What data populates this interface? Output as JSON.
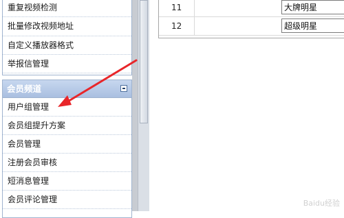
{
  "sidebar": {
    "top_items": [
      {
        "label": "重复视频检测"
      },
      {
        "label": "批量修改视频地址"
      },
      {
        "label": "自定义播放器格式"
      },
      {
        "label": "举报信管理"
      }
    ],
    "member_panel": {
      "title": "会员频道",
      "items": [
        {
          "label": "用户组管理"
        },
        {
          "label": "会员组提升方案"
        },
        {
          "label": "会员管理"
        },
        {
          "label": "注册会员审核"
        },
        {
          "label": "短消息管理"
        },
        {
          "label": "会员评论管理"
        }
      ]
    }
  },
  "table": {
    "rows": [
      {
        "num": "11",
        "name": "大牌明星"
      },
      {
        "num": "12",
        "name": "超级明星"
      }
    ]
  },
  "annotation": {
    "arrow_color": "#e8262a"
  },
  "watermark": {
    "text": "Baidu经验"
  }
}
